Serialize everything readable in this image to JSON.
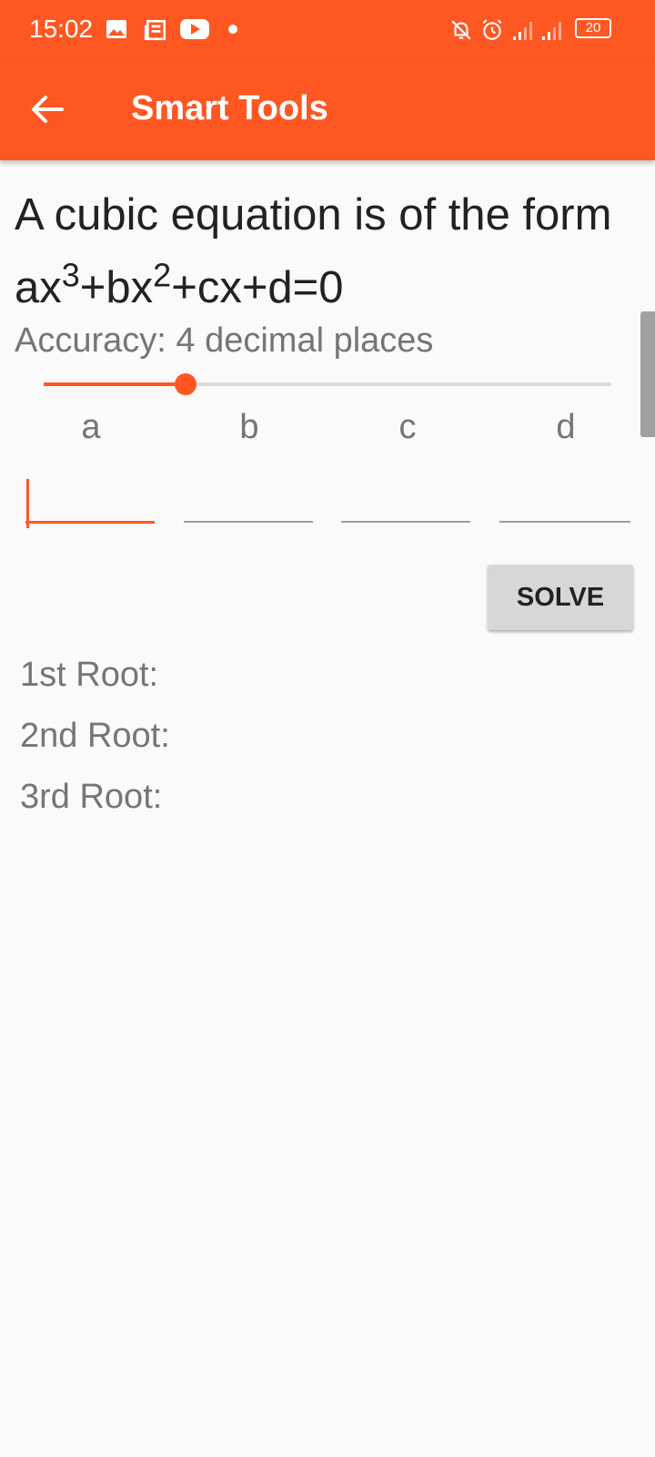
{
  "status_bar": {
    "time": "15:02",
    "battery": "20",
    "icons": [
      "image-icon",
      "news-icon",
      "youtube-icon",
      "dot-icon",
      "bell-off-icon",
      "alarm-icon",
      "signal-icon",
      "signal-icon",
      "battery-icon"
    ]
  },
  "app_bar": {
    "title": "Smart Tools",
    "back_icon": "arrow-back-icon"
  },
  "content": {
    "heading_prefix": "A cubic equation is of the form ax",
    "exp3": "3",
    "mid1": "+bx",
    "exp2": "2",
    "heading_suffix": "+cx+d=0",
    "accuracy_label": "Accuracy: 4 decimal places",
    "accuracy_slider_value": 0.25,
    "coefficients": [
      "a",
      "b",
      "c",
      "d"
    ],
    "inputs": {
      "a": "",
      "b": "",
      "c": "",
      "d": ""
    },
    "solve_button": "SOLVE",
    "roots": [
      "1st Root:",
      "2nd Root:",
      "3rd Root:"
    ]
  },
  "colors": {
    "accent": "#ff5722",
    "background": "#fafafa",
    "button_bg": "#d6d7d7"
  }
}
